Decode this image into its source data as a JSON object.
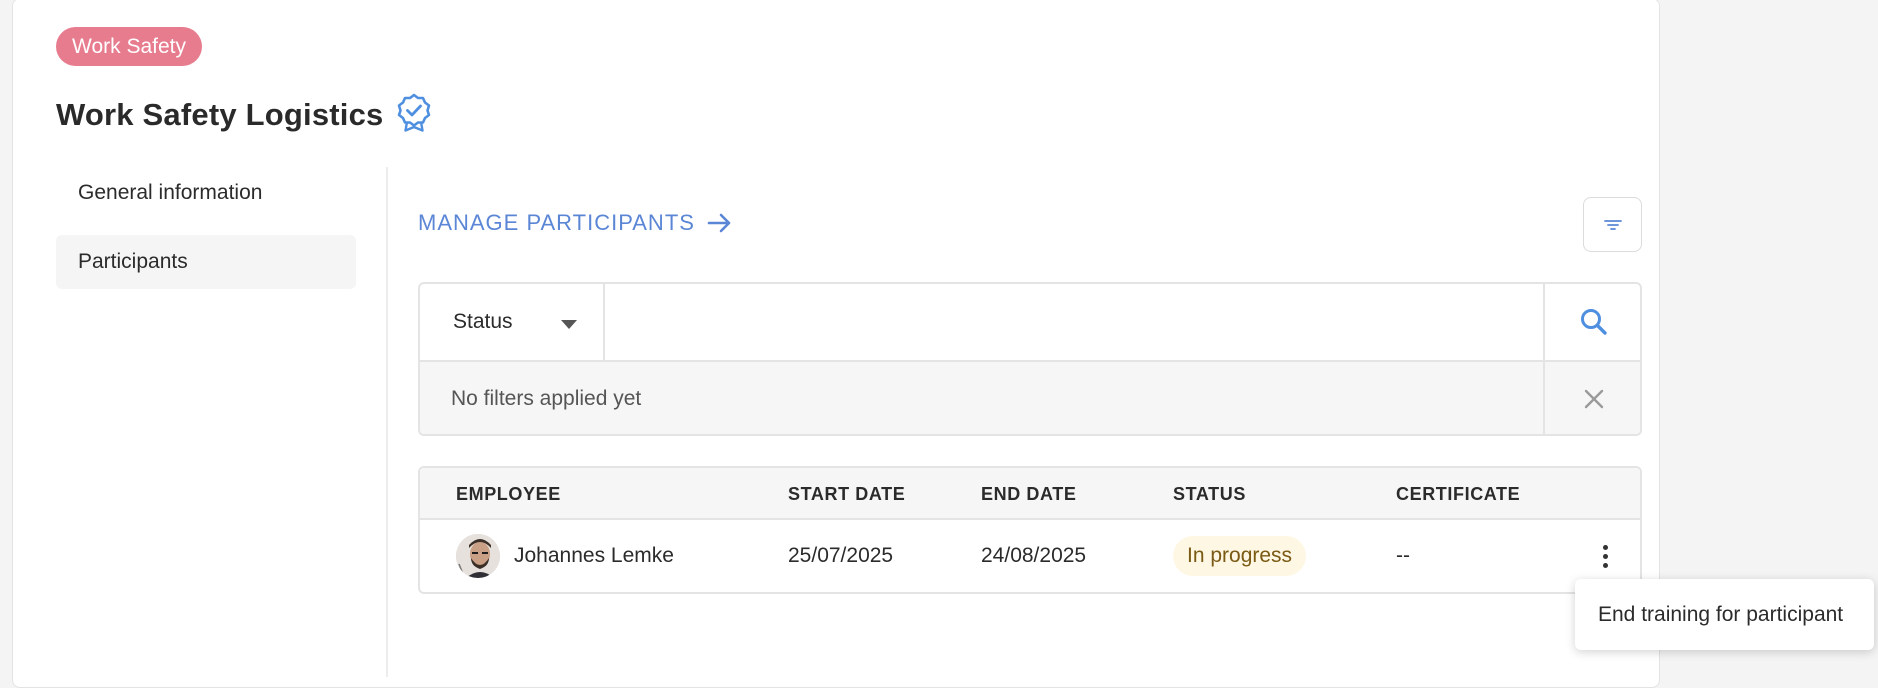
{
  "header": {
    "tag": "Work Safety",
    "title": "Work Safety Logistics",
    "badge_icon": "verified-badge-icon"
  },
  "sidebar": {
    "items": [
      {
        "label": "General information",
        "active": false
      },
      {
        "label": "Participants",
        "active": true
      }
    ]
  },
  "toolbar": {
    "manage_label": "MANAGE PARTICIPANTS",
    "manage_icon": "arrow-right-icon",
    "filter_icon": "filter-icon"
  },
  "search": {
    "select_value": "Status",
    "input_value": "",
    "placeholder": "",
    "search_icon": "search-icon",
    "filters_text": "No filters applied yet",
    "clear_icon": "close-icon"
  },
  "table": {
    "columns": [
      "EMPLOYEE",
      "START DATE",
      "END DATE",
      "STATUS",
      "CERTIFICATE"
    ],
    "rows": [
      {
        "employee": "Johannes Lemke",
        "start_date": "25/07/2025",
        "end_date": "24/08/2025",
        "status": "In progress",
        "certificate": "--"
      }
    ]
  },
  "context_menu": {
    "items": [
      "End training for participant"
    ]
  },
  "colors": {
    "accent": "#5b86d6",
    "tag": "#e77c8f",
    "status_in_progress_bg": "#fdf7e3",
    "status_in_progress_text": "#7a5a14"
  }
}
